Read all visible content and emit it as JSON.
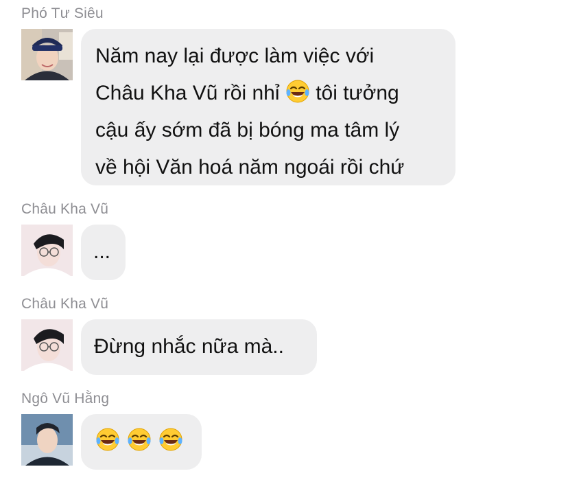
{
  "messages": [
    {
      "sender": "Phó Tư Siêu",
      "avatar_icon": "avatar-boy-cap-icon",
      "text_line1": "Năm nay lại được làm việc với",
      "text_line2_a": "Châu Kha Vũ rồi nhỉ",
      "text_line2_b": "tôi tưởng",
      "text_line3": "cậu ấy sớm đã bị bóng ma tâm lý",
      "text_line4": "về hội Văn hoá năm ngoái rồi chứ",
      "emoji_icon": "face-with-tears-of-joy-icon"
    },
    {
      "sender": "Châu Kha Vũ",
      "avatar_icon": "avatar-glasses-icon",
      "text": "..."
    },
    {
      "sender": "Châu Kha Vũ",
      "avatar_icon": "avatar-glasses-icon",
      "text": "Đừng nhắc nữa mà.."
    },
    {
      "sender": "Ngô Vũ Hằng",
      "avatar_icon": "avatar-portrait-icon",
      "emoji_icon": "face-with-tears-of-joy-icon",
      "emoji_count": 3
    }
  ],
  "colors": {
    "bubble": "#eeeeef",
    "sender_name": "#8e8e93",
    "text": "#111111"
  }
}
